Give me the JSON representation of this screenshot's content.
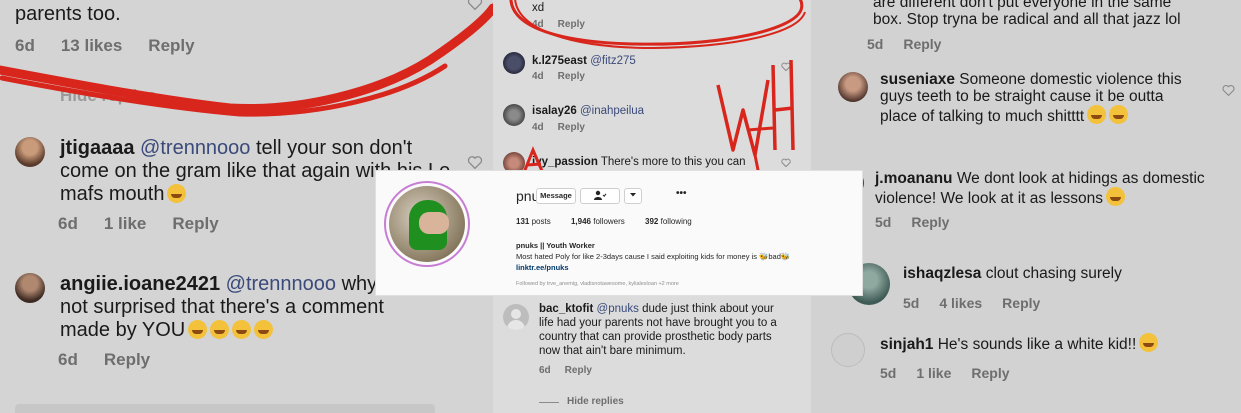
{
  "left": {
    "top_fragment": {
      "text": "parents too.",
      "age": "6d",
      "likes": "13 likes",
      "reply": "Reply"
    },
    "hidden_replies": "Hide replies",
    "comments": [
      {
        "username": "jtigaaaa",
        "mention": "@trennnooo",
        "text": "tell your son don't come on the gram like that again with his Le mafs mouth",
        "age": "6d",
        "likes": "1 like",
        "reply": "Reply"
      },
      {
        "username": "angiie.ioane2421",
        "mention": "@trennnooo",
        "text": "why not surprised that there's a comment made by YOU",
        "age": "6d",
        "reply": "Reply"
      }
    ]
  },
  "middle": {
    "top_fragment": {
      "text": "xd",
      "age": "4d",
      "reply": "Reply"
    },
    "comments": [
      {
        "username": "k.l275east",
        "mention": "@fitz275",
        "age": "4d",
        "reply": "Reply"
      },
      {
        "username": "isalay26",
        "mention": "@inahpeilua",
        "age": "4d",
        "reply": "Reply"
      },
      {
        "username": "ivy_passion",
        "text": "There's more to this you can"
      },
      {
        "username": "bac_ktofit",
        "mention": "@pnuks",
        "text": "dude just think about your life had your parents not have brought you to a country that can provide prosthetic body parts now that ain't bare minimum.",
        "age": "6d",
        "reply": "Reply"
      }
    ],
    "hide_replies": "Hide replies",
    "scribble_text": "WHAT?"
  },
  "right": {
    "top_fragment": {
      "line1": "are different don't put everyone in the same",
      "line2": "box. Stop tryna be radical and all that jazz lol",
      "age": "5d",
      "reply": "Reply"
    },
    "comments": [
      {
        "username": "suseniaxe",
        "text": "Someone domestic violence this guys teeth to be straight cause it be outta place of talking to much shitttt",
        "age": "5d",
        "reply": "Reply"
      },
      {
        "username": "j.moananu",
        "text": "We dont look at hidings as domestic violence! We look at it as lessons",
        "age": "5d",
        "reply": "Reply"
      },
      {
        "username": "ishaqzlesa",
        "text": "clout chasing surely",
        "age": "5d",
        "likes": "4 likes",
        "reply": "Reply"
      },
      {
        "username": "sinjah1",
        "text": "He's sounds like a white kid!!",
        "age": "5d",
        "likes": "1 like",
        "reply": "Reply"
      }
    ]
  },
  "profile": {
    "handle": "pnuks",
    "message_button": "Message",
    "more_glyph": "•••",
    "posts_count": "131",
    "posts_label": "posts",
    "followers_count": "1,946",
    "followers_label": "followers",
    "following_count": "392",
    "following_label": "following",
    "name": "pnuks || Youth Worker",
    "bio": "Most hated Poly for like 2-3days cause I said exploiting kids for money is 🐝bad🐝",
    "link": "linktr.ee/pnuks",
    "followed_by": "Followed by trve_anemig, vladisnotawesome, kylialesloan +2 more"
  },
  "colors": {
    "scribble": "#d9261c",
    "story_ring": "#c77dd4",
    "link": "#00376b"
  }
}
